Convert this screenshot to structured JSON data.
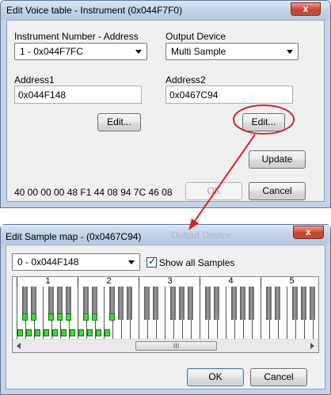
{
  "window1": {
    "title": "Edit Voice table - Instrument (0x044F7F0)",
    "close_glyph": "x",
    "instrument_label": "Instrument Number - Address",
    "instrument_value": "1 - 0x044F7FC",
    "output_label": "Output Device",
    "output_value": "Multi Sample",
    "address1_label": "Address1",
    "address1_value": "0x044F148",
    "address2_label": "Address2",
    "address2_value": "0x0467C94",
    "edit1_label": "Edit...",
    "edit2_label": "Edit...",
    "update_label": "Update",
    "hex_data": "40 00 00 00 48 F1 44 08 94 7C 46 08",
    "ok_label": "OK",
    "cancel_label": "Cancel"
  },
  "window2": {
    "title": "Edit Sample map - (0x0467C94)",
    "faded_title": "Output Device",
    "close_glyph": "x",
    "sample_value": "0 - 0x044F148",
    "show_all_label": "Show all Samples",
    "show_all_checked": true,
    "octaves": [
      "1",
      "2",
      "3",
      "4",
      "5"
    ],
    "scroll_thumb_grip": "III",
    "ok_label": "OK",
    "cancel_label": "Cancel"
  },
  "colors": {
    "highlight_red": "#e02020",
    "sample_green": "#33e02a",
    "titlebar_blue": "#c3d3e8"
  }
}
